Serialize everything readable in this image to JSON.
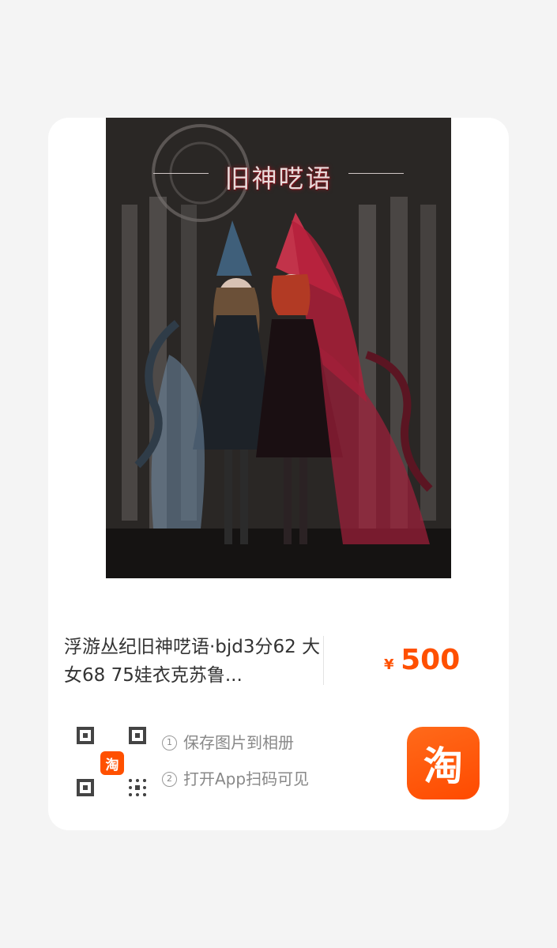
{
  "card": {
    "image": {
      "overlay_title": "旧神呓语",
      "alt": "product-photo"
    },
    "product_title": "浮游丛纪旧神呓语·bjd3分62 大女68 75娃衣克苏鲁...",
    "price": {
      "currency_symbol": "¥",
      "amount": "500",
      "color": "#ff5000"
    },
    "qr": {
      "logo_glyph": "淘"
    },
    "steps": [
      {
        "num": "1",
        "label": "保存图片到相册"
      },
      {
        "num": "2",
        "label": "打开App扫码可见"
      }
    ],
    "app_icon": {
      "glyph": "淘",
      "color": "#ff5000"
    }
  }
}
